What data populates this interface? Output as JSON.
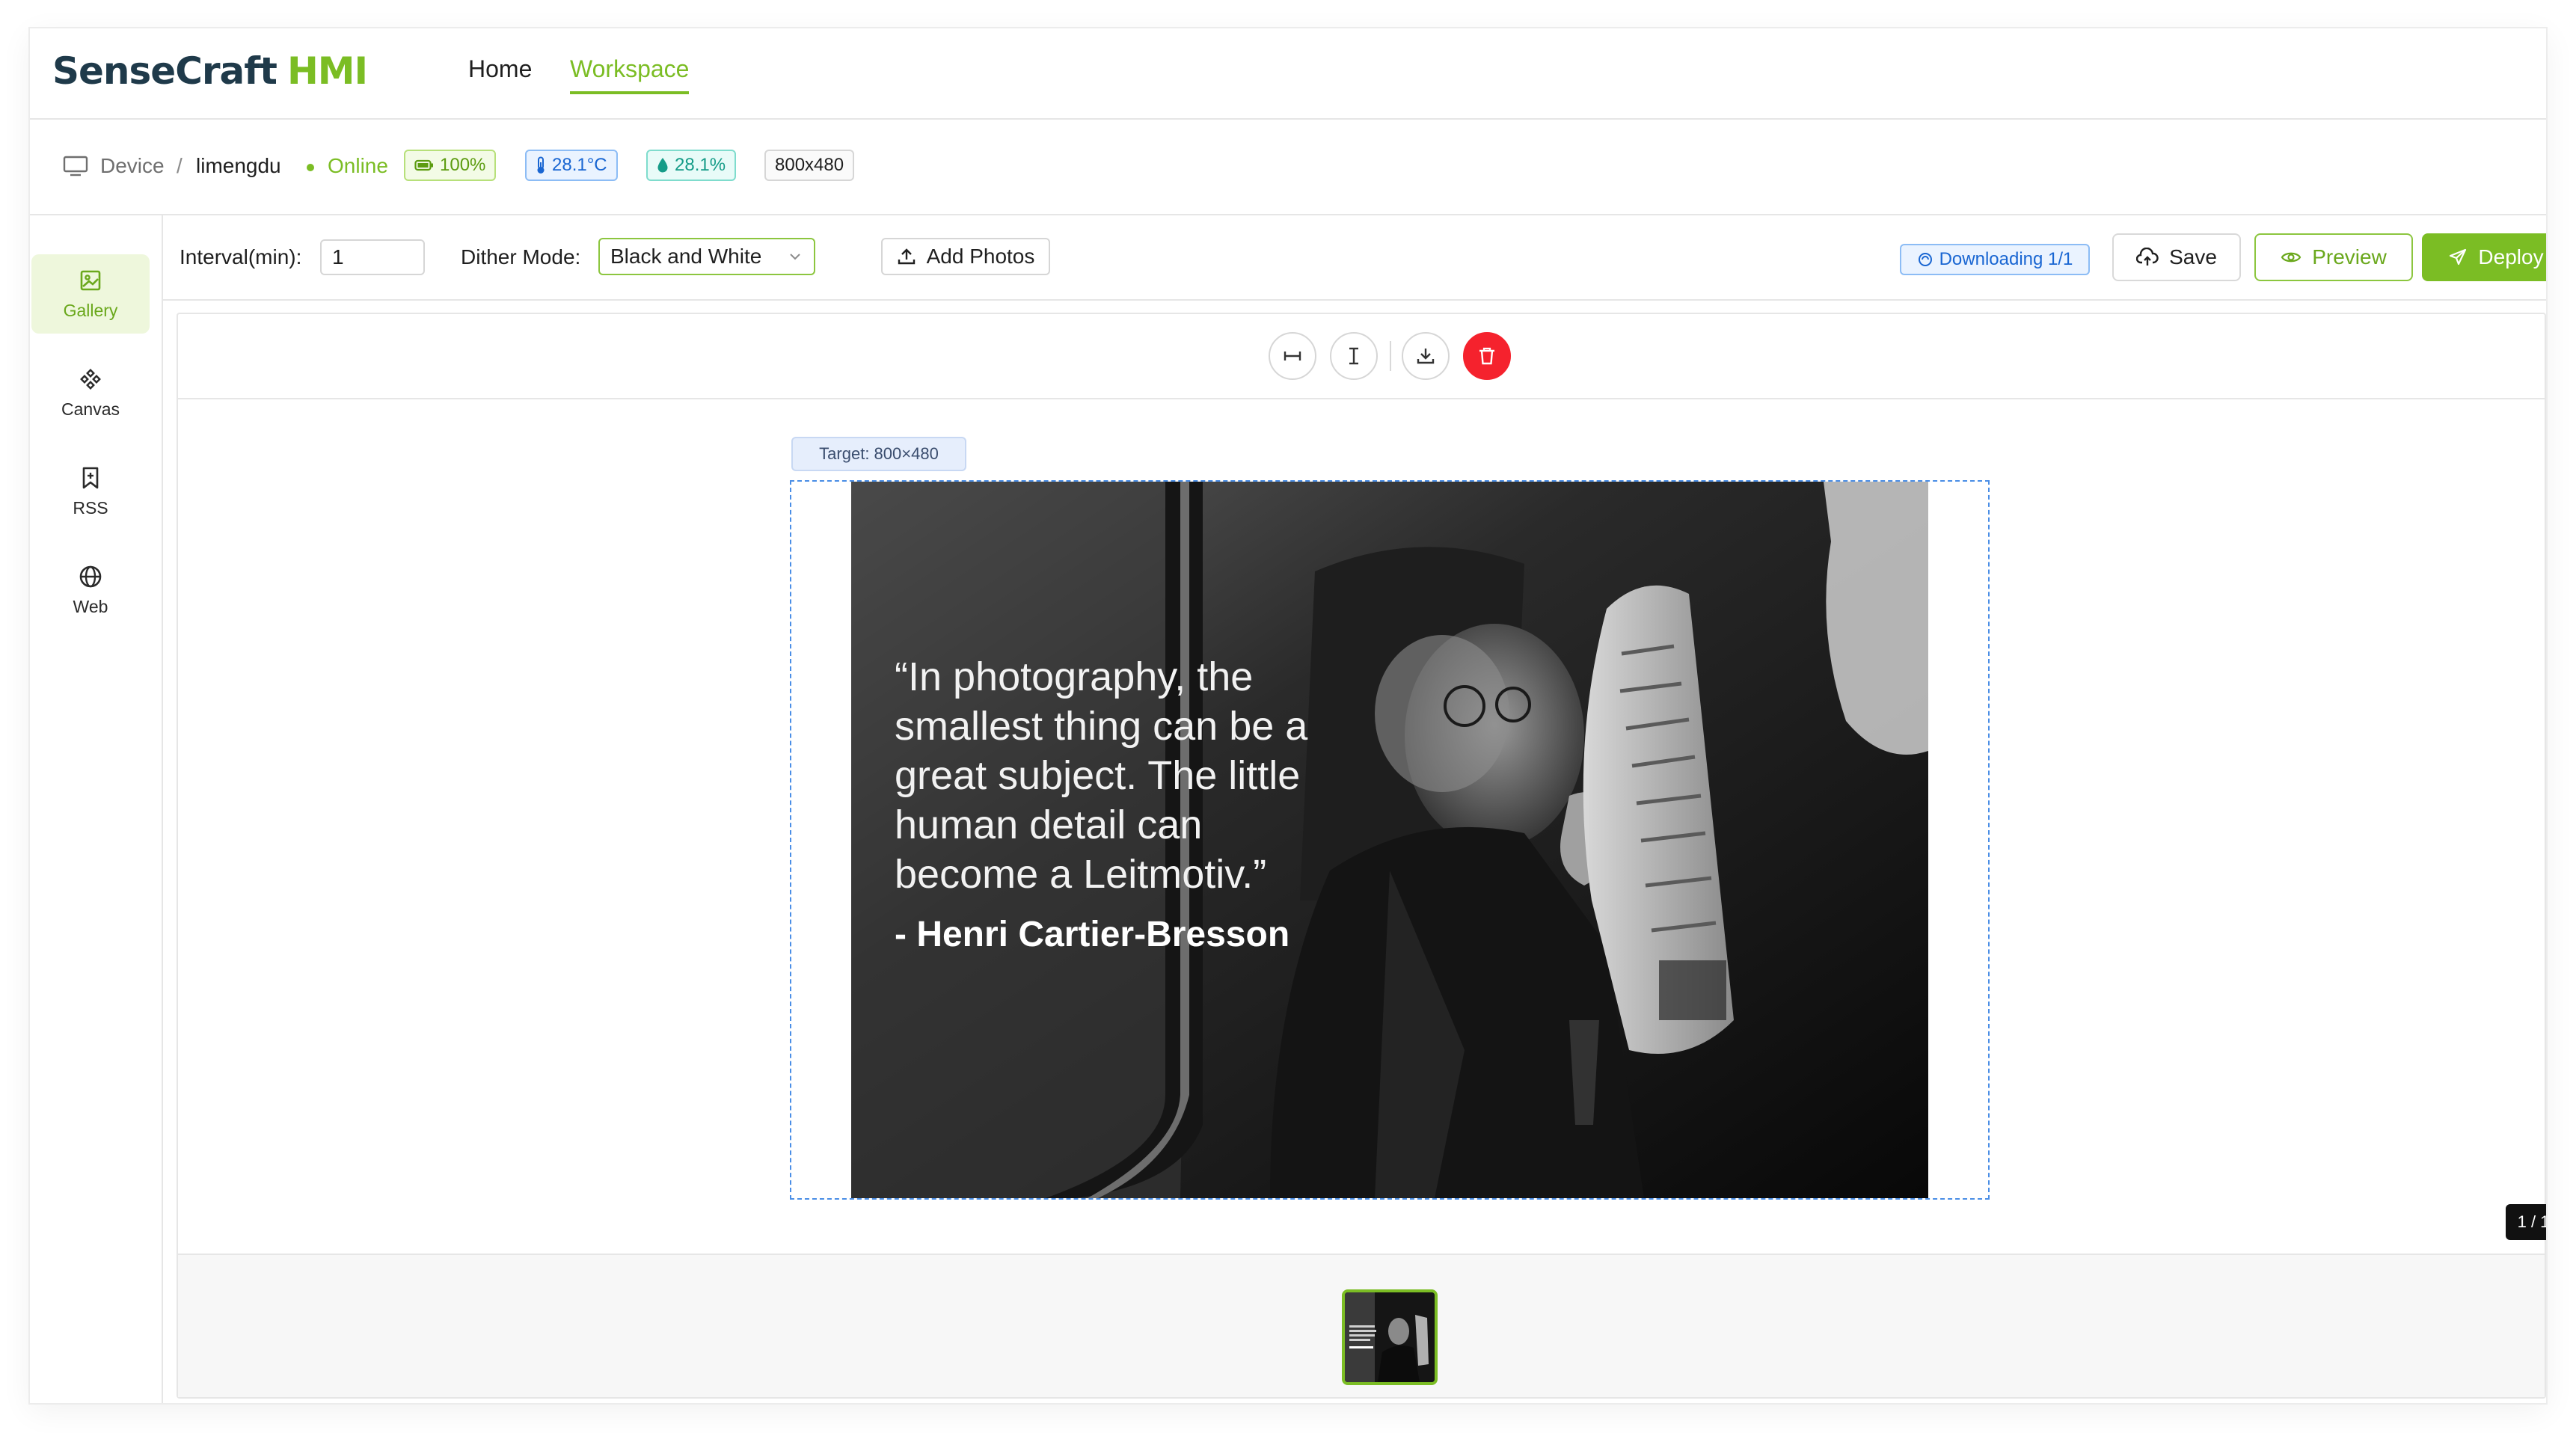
{
  "app": {
    "brand_primary": "SenseCraft",
    "brand_secondary": "HMI"
  },
  "nav": {
    "items": [
      {
        "label": "Home",
        "active": false
      },
      {
        "label": "Workspace",
        "active": true
      }
    ]
  },
  "device": {
    "crumb_root": "Device",
    "crumb_separator": "/",
    "name": "limengdu",
    "status": "Online",
    "battery": "100%",
    "temperature": "28.1°C",
    "humidity": "28.1%",
    "resolution": "800x480"
  },
  "sidebar": {
    "items": [
      {
        "label": "Gallery",
        "icon": "image-icon",
        "active": true
      },
      {
        "label": "Canvas",
        "icon": "canvas-icon",
        "active": false
      },
      {
        "label": "RSS",
        "icon": "bookmark-plus-icon",
        "active": false
      },
      {
        "label": "Web",
        "icon": "globe-icon",
        "active": false
      }
    ]
  },
  "toolbar": {
    "interval_label": "Interval(min):",
    "interval_value": "1",
    "dither_label": "Dither Mode:",
    "dither_value": "Black and White",
    "add_photos_label": "Add Photos",
    "download_status": "Downloading 1/1",
    "save_label": "Save",
    "preview_label": "Preview",
    "deploy_label": "Deploy"
  },
  "editor": {
    "target_label": "Target: 800×480",
    "quote_lines": [
      "“In photography, the",
      "smallest thing can be a",
      "great subject. The little",
      "human detail can",
      "become a Leitmotiv.”"
    ],
    "quote_author": "- Henri Cartier-Bresson",
    "page_indicator": "1 / 1"
  },
  "colors": {
    "accent": "#7bbd24",
    "danger": "#f5222d",
    "info": "#1966d2"
  }
}
